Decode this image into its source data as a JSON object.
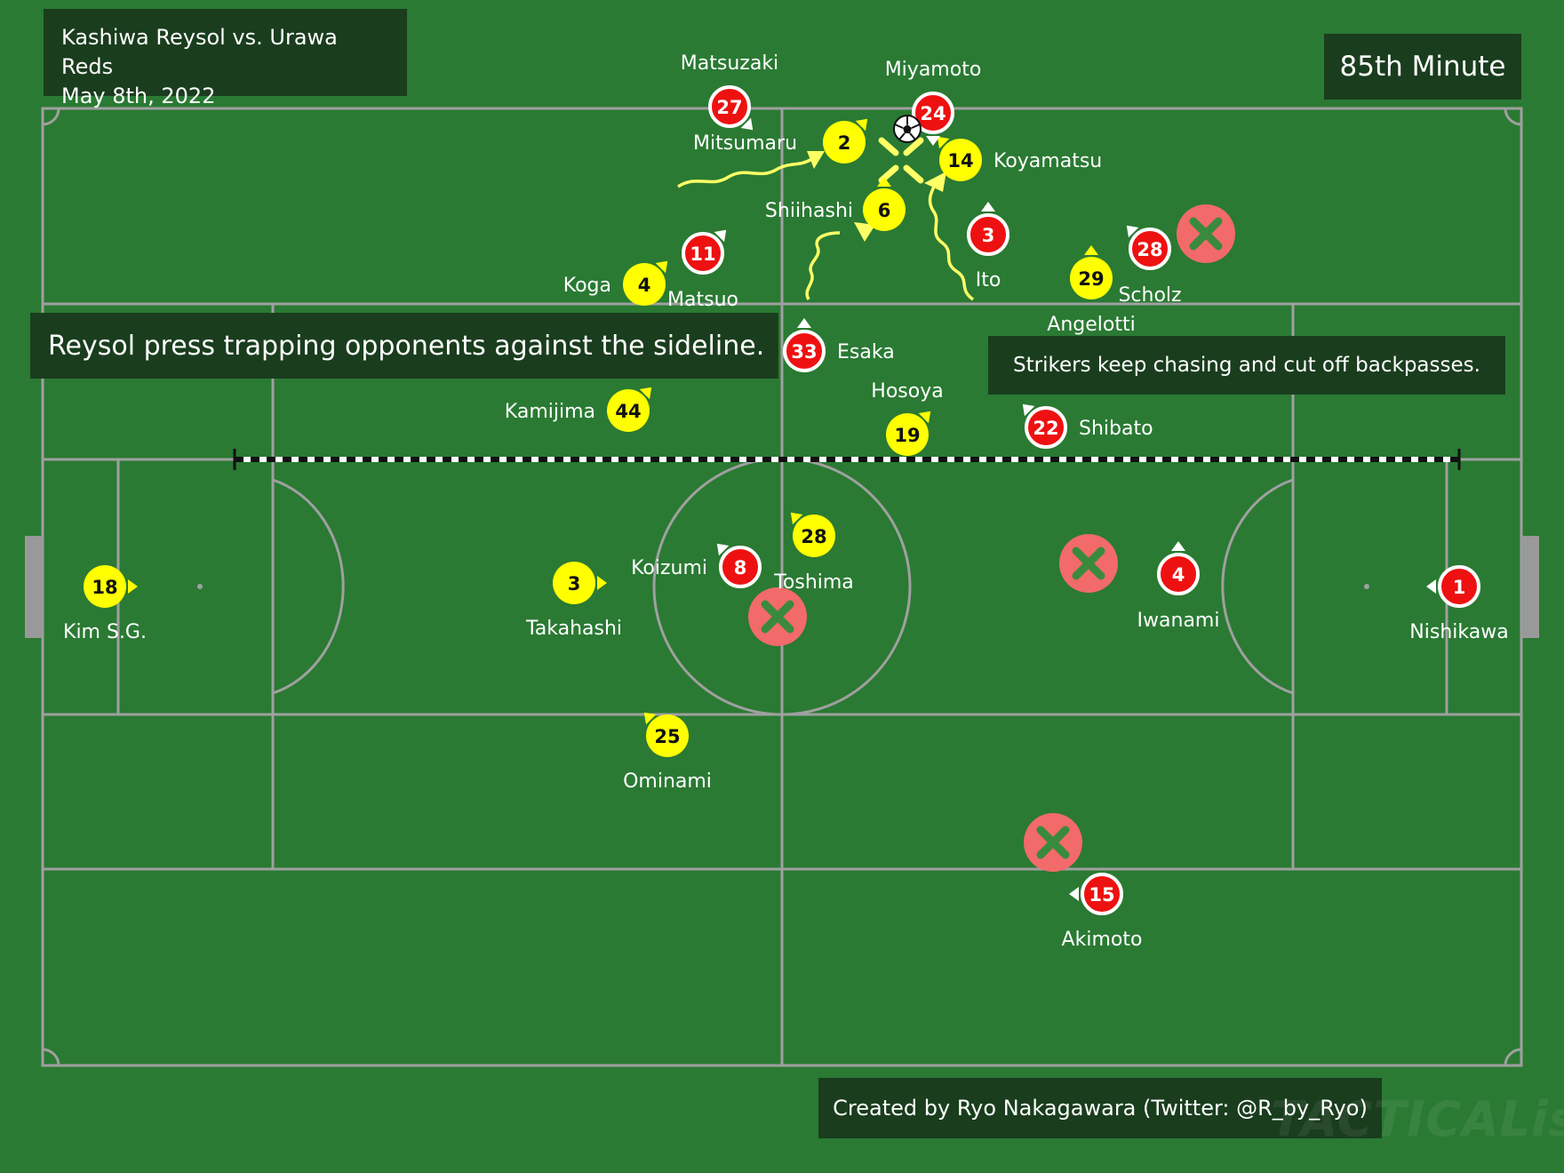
{
  "match": {
    "title": "Kashiwa Reysol vs. Urawa Reds",
    "date": "May 8th, 2022"
  },
  "minute_label": "85th Minute",
  "caption": "Reysol press trapping opponents against the sideline.",
  "note": "Strikers keep chasing and cut off backpasses.",
  "credit": "Created by Ryo Nakagawara (Twitter: @R_by_Ryo)",
  "watermark": "TACTICALista",
  "colors": {
    "pitch": "#2a7a33",
    "lines": "#a0a0a0",
    "reysol": "#ffff00",
    "urawa": "#ee1111",
    "cross": "#f26a6a",
    "box": "#1a3d1e",
    "arrow": "#ffff66"
  },
  "icons": {
    "ball": "soccer-ball-icon",
    "cross": "cross-mark-icon",
    "facing": "facing-triangle-icon"
  },
  "players": {
    "reysol": [
      {
        "num": "18",
        "name": "Kim S.G.",
        "facing": "right"
      },
      {
        "num": "3",
        "name": "Takahashi",
        "facing": "right"
      },
      {
        "num": "2",
        "name": "Mitsumaru",
        "facing": "up-right"
      },
      {
        "num": "14",
        "name": "Koyamatsu",
        "facing": "up-left"
      },
      {
        "num": "6",
        "name": "Shiihashi",
        "facing": "up"
      },
      {
        "num": "4",
        "name": "Koga",
        "facing": "up-right"
      },
      {
        "num": "44",
        "name": "Kamijima",
        "facing": "up-right"
      },
      {
        "num": "29",
        "name": "Angelotti",
        "facing": "up"
      },
      {
        "num": "19",
        "name": "Hosoya",
        "facing": "up-right"
      },
      {
        "num": "28",
        "name": "Toshima",
        "facing": "up-left"
      },
      {
        "num": "25",
        "name": "Ominami",
        "facing": "up-left"
      }
    ],
    "urawa": [
      {
        "num": "27",
        "name": "Matsuzaki",
        "facing": "down-right"
      },
      {
        "num": "24",
        "name": "Miyamoto",
        "facing": "down"
      },
      {
        "num": "11",
        "name": "Matsuo",
        "facing": "up-right"
      },
      {
        "num": "3",
        "name": "Ito",
        "facing": "up"
      },
      {
        "num": "28",
        "name": "Scholz",
        "facing": "up-left"
      },
      {
        "num": "33",
        "name": "Esaka",
        "facing": "up"
      },
      {
        "num": "22",
        "name": "Shibato",
        "facing": "up-left"
      },
      {
        "num": "8",
        "name": "Koizumi",
        "facing": "up-left"
      },
      {
        "num": "4",
        "name": "Iwanami",
        "facing": "up"
      },
      {
        "num": "1",
        "name": "Nishikawa",
        "facing": "left"
      },
      {
        "num": "15",
        "name": "Akimoto",
        "facing": "left"
      }
    ]
  }
}
